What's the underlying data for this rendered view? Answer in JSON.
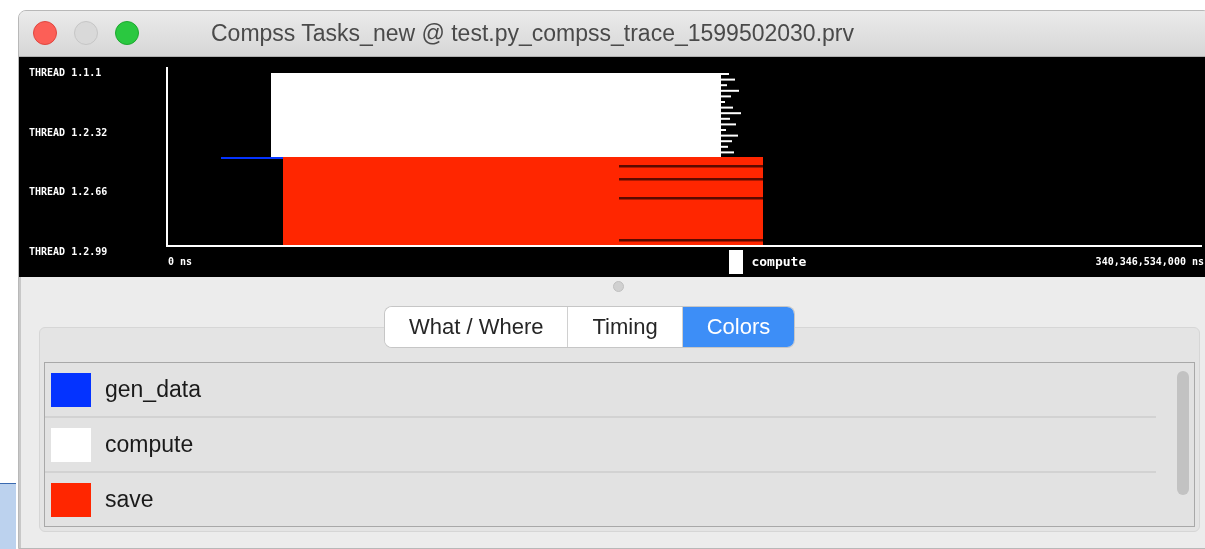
{
  "window": {
    "title": "Compss Tasks_new @ test.py_compss_trace_1599502030.prv"
  },
  "timeline": {
    "thread_labels": [
      "THREAD 1.1.1",
      "THREAD 1.2.32",
      "THREAD 1.2.66",
      "THREAD 1.2.99"
    ],
    "time_start": "0 ns",
    "time_end": "340,346,534,000 ns",
    "legend": {
      "label": "compute",
      "color": "#ffffff"
    }
  },
  "tabs": [
    {
      "label": "What / Where",
      "selected": false
    },
    {
      "label": "Timing",
      "selected": false
    },
    {
      "label": "Colors",
      "selected": true
    }
  ],
  "colors": [
    {
      "name": "gen_data",
      "color": "#0433ff"
    },
    {
      "name": "compute",
      "color": "#ffffff"
    },
    {
      "name": "save",
      "color": "#ff2600"
    }
  ]
}
